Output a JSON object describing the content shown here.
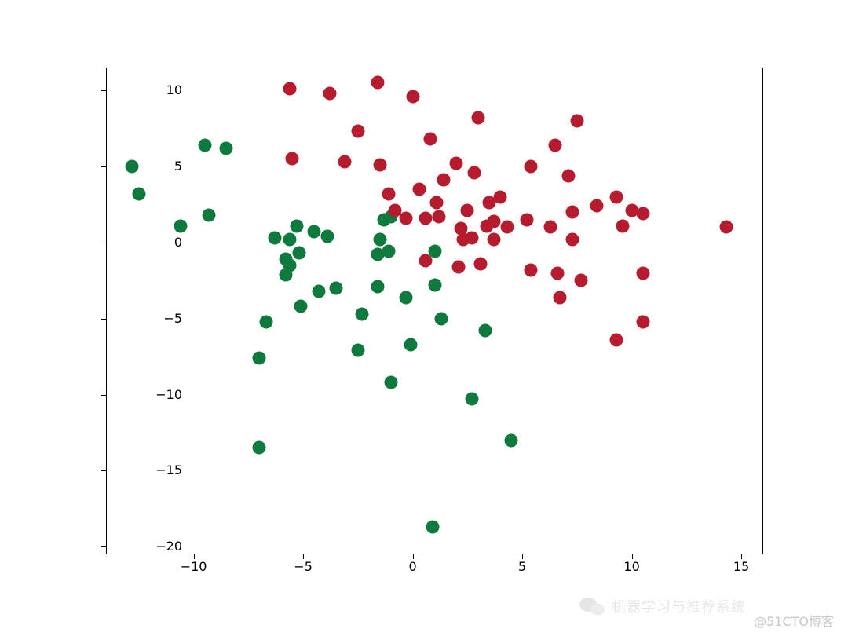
{
  "chart_data": {
    "type": "scatter",
    "title": "",
    "xlabel": "",
    "ylabel": "",
    "xlim": [
      -14,
      16
    ],
    "ylim": [
      -20.5,
      11.5
    ],
    "x_ticks": [
      -10,
      -5,
      0,
      5,
      10,
      15
    ],
    "y_ticks": [
      -20,
      -15,
      -10,
      -5,
      0,
      5,
      10
    ],
    "series": [
      {
        "name": "green",
        "color": "#0f7a3e",
        "points": [
          [
            -12.8,
            5.0
          ],
          [
            -12.5,
            3.2
          ],
          [
            -10.6,
            1.1
          ],
          [
            -9.5,
            6.4
          ],
          [
            -9.3,
            1.8
          ],
          [
            -8.5,
            6.2
          ],
          [
            -7.0,
            -7.6
          ],
          [
            -7.0,
            -13.5
          ],
          [
            -6.7,
            -5.2
          ],
          [
            -6.3,
            0.3
          ],
          [
            -5.8,
            -1.1
          ],
          [
            -5.8,
            -2.1
          ],
          [
            -5.6,
            -1.5
          ],
          [
            -5.6,
            0.2
          ],
          [
            -5.3,
            1.1
          ],
          [
            -5.2,
            -0.7
          ],
          [
            -5.1,
            -4.2
          ],
          [
            -4.5,
            0.7
          ],
          [
            -4.3,
            -3.2
          ],
          [
            -3.9,
            0.4
          ],
          [
            -3.5,
            -3.0
          ],
          [
            -2.5,
            -7.1
          ],
          [
            -2.3,
            -4.7
          ],
          [
            -1.6,
            -0.8
          ],
          [
            -1.6,
            -2.9
          ],
          [
            -1.5,
            0.2
          ],
          [
            -1.3,
            1.5
          ],
          [
            -1.1,
            -0.6
          ],
          [
            -1.0,
            1.7
          ],
          [
            -1.0,
            -9.2
          ],
          [
            -0.3,
            -3.6
          ],
          [
            -0.1,
            -6.7
          ],
          [
            0.9,
            -18.7
          ],
          [
            1.0,
            -2.8
          ],
          [
            1.0,
            -0.6
          ],
          [
            1.3,
            -5.0
          ],
          [
            2.7,
            -10.3
          ],
          [
            3.3,
            -5.8
          ],
          [
            4.5,
            -13.0
          ]
        ]
      },
      {
        "name": "red",
        "color": "#b71c2e",
        "points": [
          [
            -5.6,
            10.1
          ],
          [
            -5.5,
            5.5
          ],
          [
            -3.8,
            9.8
          ],
          [
            -3.1,
            5.3
          ],
          [
            -2.5,
            7.3
          ],
          [
            -1.6,
            10.5
          ],
          [
            -1.5,
            5.1
          ],
          [
            -1.1,
            3.2
          ],
          [
            -0.8,
            2.1
          ],
          [
            -0.3,
            1.6
          ],
          [
            0.0,
            9.6
          ],
          [
            0.3,
            3.5
          ],
          [
            0.6,
            1.6
          ],
          [
            0.6,
            -1.2
          ],
          [
            0.8,
            6.8
          ],
          [
            1.1,
            2.6
          ],
          [
            1.2,
            1.7
          ],
          [
            1.4,
            4.1
          ],
          [
            2.0,
            5.2
          ],
          [
            2.1,
            -1.6
          ],
          [
            2.2,
            0.9
          ],
          [
            2.3,
            0.2
          ],
          [
            2.5,
            2.1
          ],
          [
            2.7,
            0.3
          ],
          [
            2.8,
            4.6
          ],
          [
            3.0,
            8.2
          ],
          [
            3.1,
            -1.4
          ],
          [
            3.4,
            1.1
          ],
          [
            3.5,
            2.6
          ],
          [
            3.7,
            1.4
          ],
          [
            3.7,
            0.2
          ],
          [
            4.0,
            3.0
          ],
          [
            4.3,
            1.0
          ],
          [
            5.2,
            1.5
          ],
          [
            5.4,
            5.0
          ],
          [
            5.4,
            -1.8
          ],
          [
            6.3,
            1.0
          ],
          [
            6.5,
            6.4
          ],
          [
            6.6,
            -2.0
          ],
          [
            6.7,
            -3.6
          ],
          [
            7.1,
            4.4
          ],
          [
            7.3,
            2.0
          ],
          [
            7.3,
            0.2
          ],
          [
            7.5,
            8.0
          ],
          [
            7.7,
            -2.5
          ],
          [
            8.4,
            2.4
          ],
          [
            9.3,
            -6.4
          ],
          [
            9.3,
            3.0
          ],
          [
            9.6,
            1.1
          ],
          [
            10.0,
            2.1
          ],
          [
            10.5,
            1.9
          ],
          [
            10.5,
            -2.0
          ],
          [
            10.5,
            -5.2
          ],
          [
            14.3,
            1.0
          ]
        ]
      }
    ]
  },
  "watermark": "@51CTO博客",
  "wm2": "机器学习与推荐系统"
}
